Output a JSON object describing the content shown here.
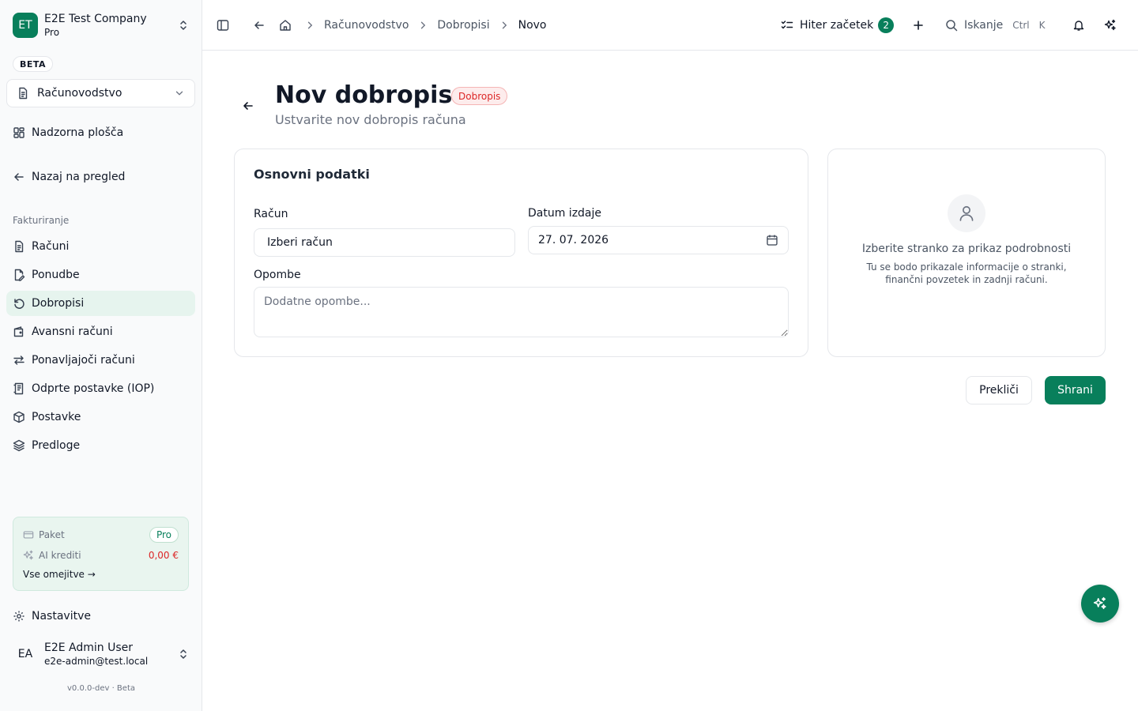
{
  "sidebar": {
    "company": {
      "initials": "ET",
      "name": "E2E Test Company",
      "plan": "Pro"
    },
    "beta_label": "BETA",
    "module": {
      "label": "Računovodstvo",
      "icon": "document-icon"
    },
    "top_items": [
      {
        "label": "Nadzorna plošča",
        "icon": "dashboard-icon"
      },
      {
        "label": "Nazaj na pregled",
        "icon": "arrow-left-icon"
      }
    ],
    "section_label": "Fakturiranje",
    "items": [
      {
        "label": "Računi",
        "icon": "file-icon"
      },
      {
        "label": "Ponudbe",
        "icon": "edit-file-icon"
      },
      {
        "label": "Dobropisi",
        "icon": "undo-icon",
        "active": true
      },
      {
        "label": "Avansni računi",
        "icon": "wallet-icon"
      },
      {
        "label": "Ponavljajoči računi",
        "icon": "repeat-icon"
      },
      {
        "label": "Odprte postavke (IOP)",
        "icon": "receipt-icon"
      },
      {
        "label": "Postavke",
        "icon": "package-icon"
      },
      {
        "label": "Predloge",
        "icon": "layers-icon"
      }
    ],
    "plan_card": {
      "plan_label": "Paket",
      "plan_value": "Pro",
      "credits_label": "AI krediti",
      "credits_value": "0,00 €",
      "limits_link": "Vse omejitve →"
    },
    "settings_label": "Nastavitve",
    "user": {
      "initials": "EA",
      "name": "E2E Admin User",
      "email": "e2e-admin@test.local"
    },
    "version": "v0.0.0-dev · Beta"
  },
  "header": {
    "breadcrumbs": [
      "Računovodstvo",
      "Dobropisi",
      "Novo"
    ],
    "quick_start": {
      "label": "Hiter začetek",
      "count": "2"
    },
    "search": {
      "label": "Iskanje",
      "shortcut_mod": "Ctrl",
      "shortcut_key": "K"
    }
  },
  "page": {
    "title": "Nov dobropis",
    "badge": "Dobropis",
    "subtitle": "Ustvarite nov dobropis računa"
  },
  "form": {
    "section_title": "Osnovni podatki",
    "invoice_label": "Račun",
    "invoice_value": "Izberi račun",
    "date_label": "Datum izdaje",
    "date_value": "27. 07. 2026",
    "notes_label": "Opombe",
    "notes_placeholder": "Dodatne opombe..."
  },
  "customer_panel": {
    "title": "Izberite stranko za prikaz podrobnosti",
    "description": "Tu se bodo prikazale informacije o stranki, finančni povzetek in zadnji računi."
  },
  "actions": {
    "cancel": "Prekliči",
    "save": "Shrani"
  },
  "colors": {
    "accent": "#087f5b",
    "active_nav_bg": "#e6f4ee",
    "danger": "#dc2626"
  }
}
